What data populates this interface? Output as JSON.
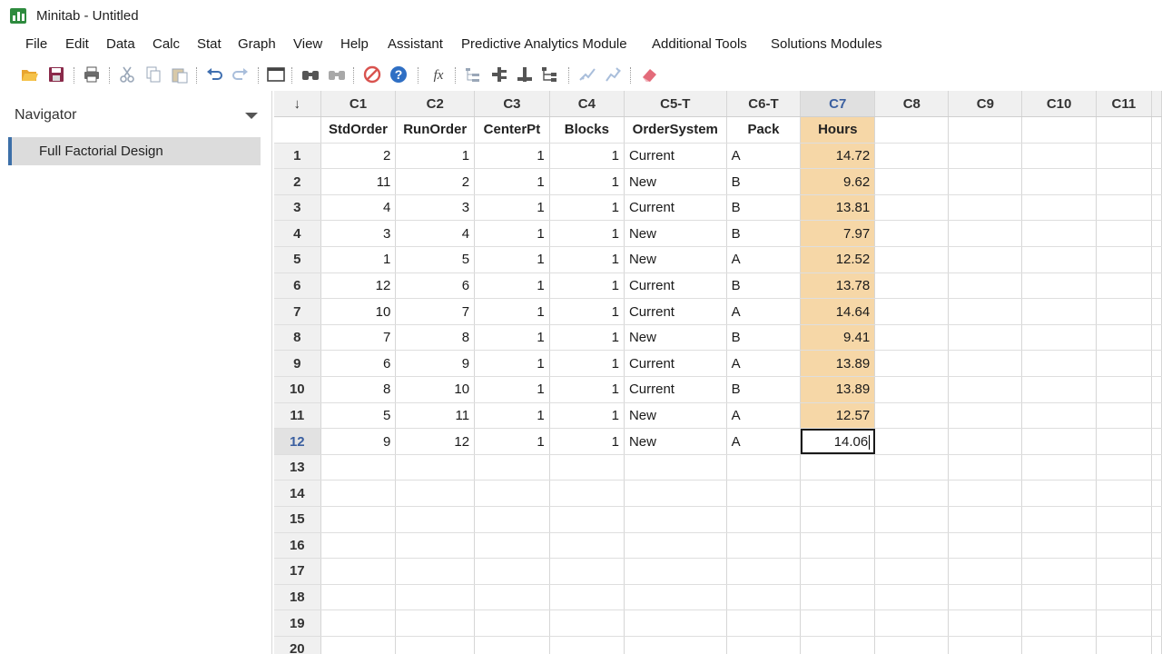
{
  "window": {
    "title": "Minitab - Untitled"
  },
  "menu": [
    "File",
    "Edit",
    "Data",
    "Calc",
    "Stat",
    "Graph",
    "View",
    "Help",
    "Assistant",
    "Predictive Analytics Module",
    "Additional Tools",
    "Solutions Modules"
  ],
  "toolbar": {
    "icons": [
      "open-icon",
      "save-icon",
      "print-icon",
      "cut-icon",
      "copy-icon",
      "paste-icon",
      "undo-icon",
      "redo-icon",
      "window-icon",
      "find-icon",
      "replace-icon",
      "cancel-icon",
      "help-icon",
      "formula-icon",
      "tree-icon",
      "hierarchy-icon",
      "expand-icon",
      "graph-brush-icon",
      "graph-edit-icon",
      "eraser-icon"
    ]
  },
  "navigator": {
    "title": "Navigator",
    "items": [
      {
        "label": "Full Factorial Design"
      }
    ]
  },
  "worksheet": {
    "corner_label": "↓",
    "column_ids": [
      "C1",
      "C2",
      "C3",
      "C4",
      "C5-T",
      "C6-T",
      "C7",
      "C8",
      "C9",
      "C10",
      "C11"
    ],
    "column_names": [
      "StdOrder",
      "RunOrder",
      "CenterPt",
      "Blocks",
      "OrderSystem",
      "Pack",
      "Hours",
      "",
      "",
      "",
      ""
    ],
    "rows": [
      [
        "2",
        "1",
        "1",
        "1",
        "Current",
        "A",
        "14.72"
      ],
      [
        "11",
        "2",
        "1",
        "1",
        "New",
        "B",
        "9.62"
      ],
      [
        "4",
        "3",
        "1",
        "1",
        "Current",
        "B",
        "13.81"
      ],
      [
        "3",
        "4",
        "1",
        "1",
        "New",
        "B",
        "7.97"
      ],
      [
        "1",
        "5",
        "1",
        "1",
        "New",
        "A",
        "12.52"
      ],
      [
        "12",
        "6",
        "1",
        "1",
        "Current",
        "B",
        "13.78"
      ],
      [
        "10",
        "7",
        "1",
        "1",
        "Current",
        "A",
        "14.64"
      ],
      [
        "7",
        "8",
        "1",
        "1",
        "New",
        "B",
        "9.41"
      ],
      [
        "6",
        "9",
        "1",
        "1",
        "Current",
        "A",
        "13.89"
      ],
      [
        "8",
        "10",
        "1",
        "1",
        "Current",
        "B",
        "13.89"
      ],
      [
        "5",
        "11",
        "1",
        "1",
        "New",
        "A",
        "12.57"
      ],
      [
        "9",
        "12",
        "1",
        "1",
        "New",
        "A",
        "14.06"
      ]
    ],
    "row_numbers": [
      "1",
      "2",
      "3",
      "4",
      "5",
      "6",
      "7",
      "8",
      "9",
      "10",
      "11",
      "12",
      "13",
      "14",
      "15",
      "16",
      "17",
      "18",
      "19",
      "20"
    ],
    "selected_column": "C7",
    "active_row": "12",
    "colors": {
      "selection": "#f6d7a7",
      "header_bg": "#f0f0f0",
      "nav_accent": "#3c6fa8",
      "app_green": "#2e8b3e"
    }
  }
}
